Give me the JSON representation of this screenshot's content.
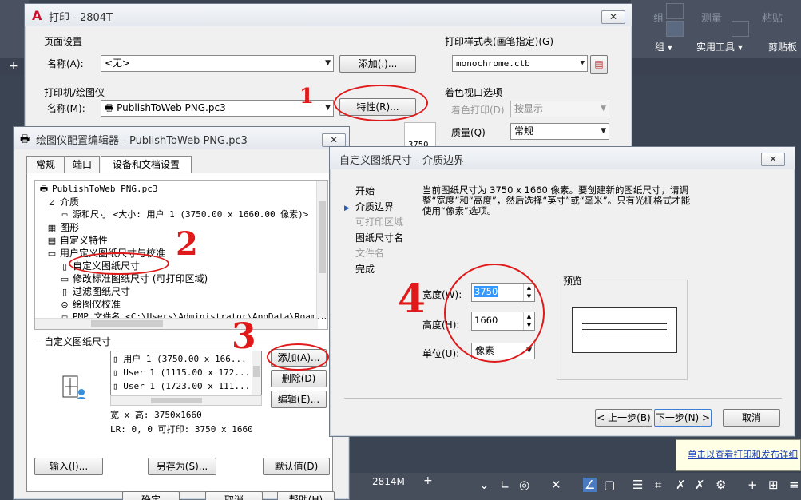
{
  "background_app": {
    "ribbon_labels": [
      "组",
      "实用工具",
      "剪贴板"
    ],
    "ribbon_ghost": [
      "组",
      "测量",
      "粘贴"
    ],
    "memory": "2814M",
    "balloon_link": "单击以查看打印和发布详细"
  },
  "print_dialog": {
    "title": "打印 - 2804T",
    "page_setup": {
      "section": "页面设置",
      "name_label": "名称(A):",
      "name_value": "<无>",
      "add_button": "添加(.)..."
    },
    "printer": {
      "section": "打印机/绘图仪",
      "name_label": "名称(M):",
      "name_value": "PublishToWeb PNG.pc3",
      "properties_button": "特性(R)...",
      "paper_preview": "3750"
    },
    "plot_style": {
      "section": "打印样式表(画笔指定)(G)",
      "value": "monochrome.ctb"
    },
    "shaded": {
      "section": "着色视口选项",
      "shaded_plot_label": "着色打印(D)",
      "shaded_plot_value": "按显示",
      "quality_label": "质量(Q)",
      "quality_value": "常规"
    }
  },
  "plotter_editor": {
    "title": "绘图仪配置编辑器 - PublishToWeb PNG.pc3",
    "tabs": [
      "常规",
      "端口",
      "设备和文档设置"
    ],
    "active_tab": 2,
    "tree": [
      {
        "label": "PublishToWeb PNG.pc3",
        "icon": "printer-icon",
        "mono": true
      },
      {
        "label": "介质",
        "icon": "media-icon",
        "mono": false
      },
      {
        "label": "源和尺寸 <大小: 用户 1 (3750.00 x 1660.00 像素)>",
        "icon": "page-icon",
        "mono": true
      },
      {
        "label": "图形",
        "icon": "graphics-icon",
        "mono": false
      },
      {
        "label": "自定义特性",
        "icon": "properties-icon",
        "mono": false
      },
      {
        "label": "用户定义图纸尺寸与校准",
        "icon": "folder-icon",
        "mono": false
      },
      {
        "label": "自定义图纸尺寸",
        "icon": "custom-paper-icon",
        "mono": false
      },
      {
        "label": "修改标准图纸尺寸 (可打印区域)",
        "icon": "modify-icon",
        "mono": false
      },
      {
        "label": "过滤图纸尺寸",
        "icon": "filter-icon",
        "mono": false
      },
      {
        "label": "绘图仪校准",
        "icon": "calibrate-icon",
        "mono": false
      },
      {
        "label": "PMP 文件名 <C:\\Users\\Administrator\\AppData\\Roaming\\...>",
        "icon": "pmp-icon",
        "mono": true
      }
    ],
    "custom_sizes": {
      "section": "自定义图纸尺寸",
      "list": [
        "用户 1 (3750.00 x 166...",
        "User 1 (1115.00 x 172...",
        "User 1 (1723.00 x 111..."
      ],
      "add_button": "添加(A)...",
      "delete_button": "删除(D)",
      "edit_button": "编辑(E)...",
      "size_info": "宽 x 高: 3750x1660",
      "lr_info": "LR: 0, 0   可打印: 3750 x 1660"
    },
    "bottom_buttons": [
      "输入(I)...",
      "另存为(S)...",
      "默认值(D)"
    ],
    "footer_buttons": [
      "确定",
      "取消",
      "帮助(H)"
    ]
  },
  "wizard": {
    "title": "自定义图纸尺寸 - 介质边界",
    "steps": [
      {
        "label": "开始",
        "state": "done"
      },
      {
        "label": "介质边界",
        "state": "current"
      },
      {
        "label": "可打印区域",
        "state": "disabled"
      },
      {
        "label": "图纸尺寸名",
        "state": "done"
      },
      {
        "label": "文件名",
        "state": "disabled"
      },
      {
        "label": "完成",
        "state": "done"
      }
    ],
    "description": "当前图纸尺寸为 3750 x 1660 像素。要创建新的图纸尺寸，请调整“宽度”和“高度”，然后选择“英寸”或“毫米”。只有光栅格式才能使用“像素”选项。",
    "width_label": "宽度(W):",
    "width_value": "3750",
    "height_label": "高度(H):",
    "height_value": "1660",
    "units_label": "单位(U):",
    "units_value": "像素",
    "preview_label": "预览",
    "back_button": "< 上一步(B)",
    "next_button": "下一步(N) >",
    "cancel_button": "取消"
  },
  "annotations": [
    "1",
    "2",
    "3",
    "4"
  ],
  "colors": {
    "annotation": "#e01a1a",
    "selection": "#3399ff",
    "link": "#1a3fb0"
  }
}
